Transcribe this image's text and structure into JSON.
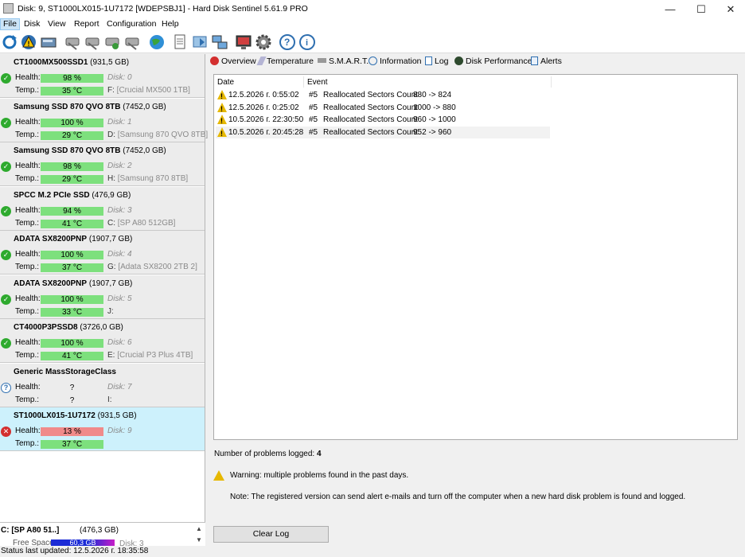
{
  "window": {
    "title": "Disk: 9, ST1000LX015-1U7172 [WDEPSBJ1]  -  Hard Disk Sentinel 5.61.9 PRO"
  },
  "menu": [
    "File",
    "Disk",
    "View",
    "Report",
    "Configuration",
    "Help"
  ],
  "toolbar_icons": [
    "refresh-icon",
    "alert-icon",
    "disk-icon",
    "wrench-icon",
    "wrench-icon",
    "wrench-icon",
    "wrench-icon",
    "globe-icon",
    "report-icon",
    "send-report-icon",
    "network-icon",
    "monitor-icon",
    "gear-icon",
    "help-icon",
    "info-icon"
  ],
  "disks": [
    {
      "name": "CT1000MX500SSD1",
      "size": "(931,5 GB)",
      "health_label": "Health:",
      "health": "98 %",
      "health_pct": 98,
      "disk": "Disk: 0",
      "temp_label": "Temp.:",
      "temp": "35 °C",
      "drive": "F:",
      "volume": "[Crucial MX500 1TB]",
      "status": "ok"
    },
    {
      "name": "Samsung SSD 870 QVO 8TB",
      "size": "(7452,0 GB)",
      "health_label": "Health:",
      "health": "100 %",
      "health_pct": 100,
      "disk": "Disk: 1",
      "temp_label": "Temp.:",
      "temp": "29 °C",
      "drive": "D:",
      "volume": "[Samsung 870 QVO 8TB]",
      "status": "ok"
    },
    {
      "name": "Samsung SSD 870 QVO 8TB",
      "size": "(7452,0 GB)",
      "health_label": "Health:",
      "health": "98 %",
      "health_pct": 98,
      "disk": "Disk: 2",
      "temp_label": "Temp.:",
      "temp": "29 °C",
      "drive": "H:",
      "volume": "[Samsung 870 8TB]",
      "status": "ok"
    },
    {
      "name": "SPCC M.2 PCIe SSD",
      "size": "(476,9 GB)",
      "health_label": "Health:",
      "health": "94 %",
      "health_pct": 94,
      "disk": "Disk: 3",
      "temp_label": "Temp.:",
      "temp": "41 °C",
      "drive": "C:",
      "volume": "[SP A80 512GB]",
      "status": "ok"
    },
    {
      "name": "ADATA SX8200PNP",
      "size": "(1907,7 GB)",
      "health_label": "Health:",
      "health": "100 %",
      "health_pct": 100,
      "disk": "Disk: 4",
      "temp_label": "Temp.:",
      "temp": "37 °C",
      "drive": "G:",
      "volume": "[Adata SX8200 2TB 2]",
      "status": "ok"
    },
    {
      "name": "ADATA SX8200PNP",
      "size": "(1907,7 GB)",
      "health_label": "Health:",
      "health": "100 %",
      "health_pct": 100,
      "disk": "Disk: 5",
      "temp_label": "Temp.:",
      "temp": "33 °C",
      "drive": "J:",
      "volume": "",
      "status": "ok"
    },
    {
      "name": "CT4000P3PSSD8",
      "size": "(3726,0 GB)",
      "health_label": "Health:",
      "health": "100 %",
      "health_pct": 100,
      "disk": "Disk: 6",
      "temp_label": "Temp.:",
      "temp": "41 °C",
      "drive": "E:",
      "volume": "[Crucial P3 Plus 4TB]",
      "status": "ok"
    },
    {
      "name": "Generic MassStorageClass",
      "size": "",
      "health_label": "Health:",
      "health": "?",
      "health_pct": 0,
      "disk": "Disk: 7",
      "temp_label": "Temp.:",
      "temp": "?",
      "drive": "I:",
      "volume": "",
      "status": "unknown"
    },
    {
      "name": "ST1000LX015-1U7172",
      "size": "(931,5 GB)",
      "health_label": "Health:",
      "health": "13 %",
      "health_pct": 13,
      "disk": "Disk: 9",
      "temp_label": "Temp.:",
      "temp": "37 °C",
      "drive": "",
      "volume": "",
      "status": "bad"
    }
  ],
  "partition": {
    "label": "C: [SP A80 51..]",
    "size": "(476,3 GB)",
    "free_label": "Free Space",
    "free_value": "60,3 GB",
    "disk": "Disk: 3"
  },
  "tabs": [
    {
      "label": "Overview",
      "icon": "error-icon"
    },
    {
      "label": "Temperature",
      "icon": "thermometer-icon"
    },
    {
      "label": "S.M.A.R.T.",
      "icon": "smart-icon"
    },
    {
      "label": "Information",
      "icon": "info-icon"
    },
    {
      "label": "Log",
      "icon": "log-icon"
    },
    {
      "label": "Disk Performance",
      "icon": "performance-icon"
    },
    {
      "label": "Alerts",
      "icon": "alerts-icon"
    }
  ],
  "log": {
    "columns": [
      "Date",
      "Event"
    ],
    "rows": [
      {
        "date": "12.5.2026 г. 0:55:02",
        "id": "#5",
        "attr": "Reallocated Sectors Count",
        "change": "880 -> 824"
      },
      {
        "date": "12.5.2026 г. 0:25:02",
        "id": "#5",
        "attr": "Reallocated Sectors Count",
        "change": "1000 -> 880"
      },
      {
        "date": "10.5.2026 г. 22:30:50",
        "id": "#5",
        "attr": "Reallocated Sectors Count",
        "change": "960 -> 1000"
      },
      {
        "date": "10.5.2026 г. 20:45:28",
        "id": "#5",
        "attr": "Reallocated Sectors Count",
        "change": "952 -> 960"
      }
    ]
  },
  "problems": {
    "label": "Number of problems logged:",
    "count": "4"
  },
  "warning": "Warning: multiple problems found in the past days.",
  "note": "Note: The registered version can send alert e-mails and turn off the computer when a new hard disk problem is found and logged.",
  "clear_log": "Clear Log",
  "status_bar": "Status last updated: 12.5.2026 г. 18:35:58",
  "colors": {
    "health_good": "#7de07d",
    "health_bad": "#f08a8a",
    "selected": "#cdf1fc",
    "warn": "#e6b800"
  }
}
